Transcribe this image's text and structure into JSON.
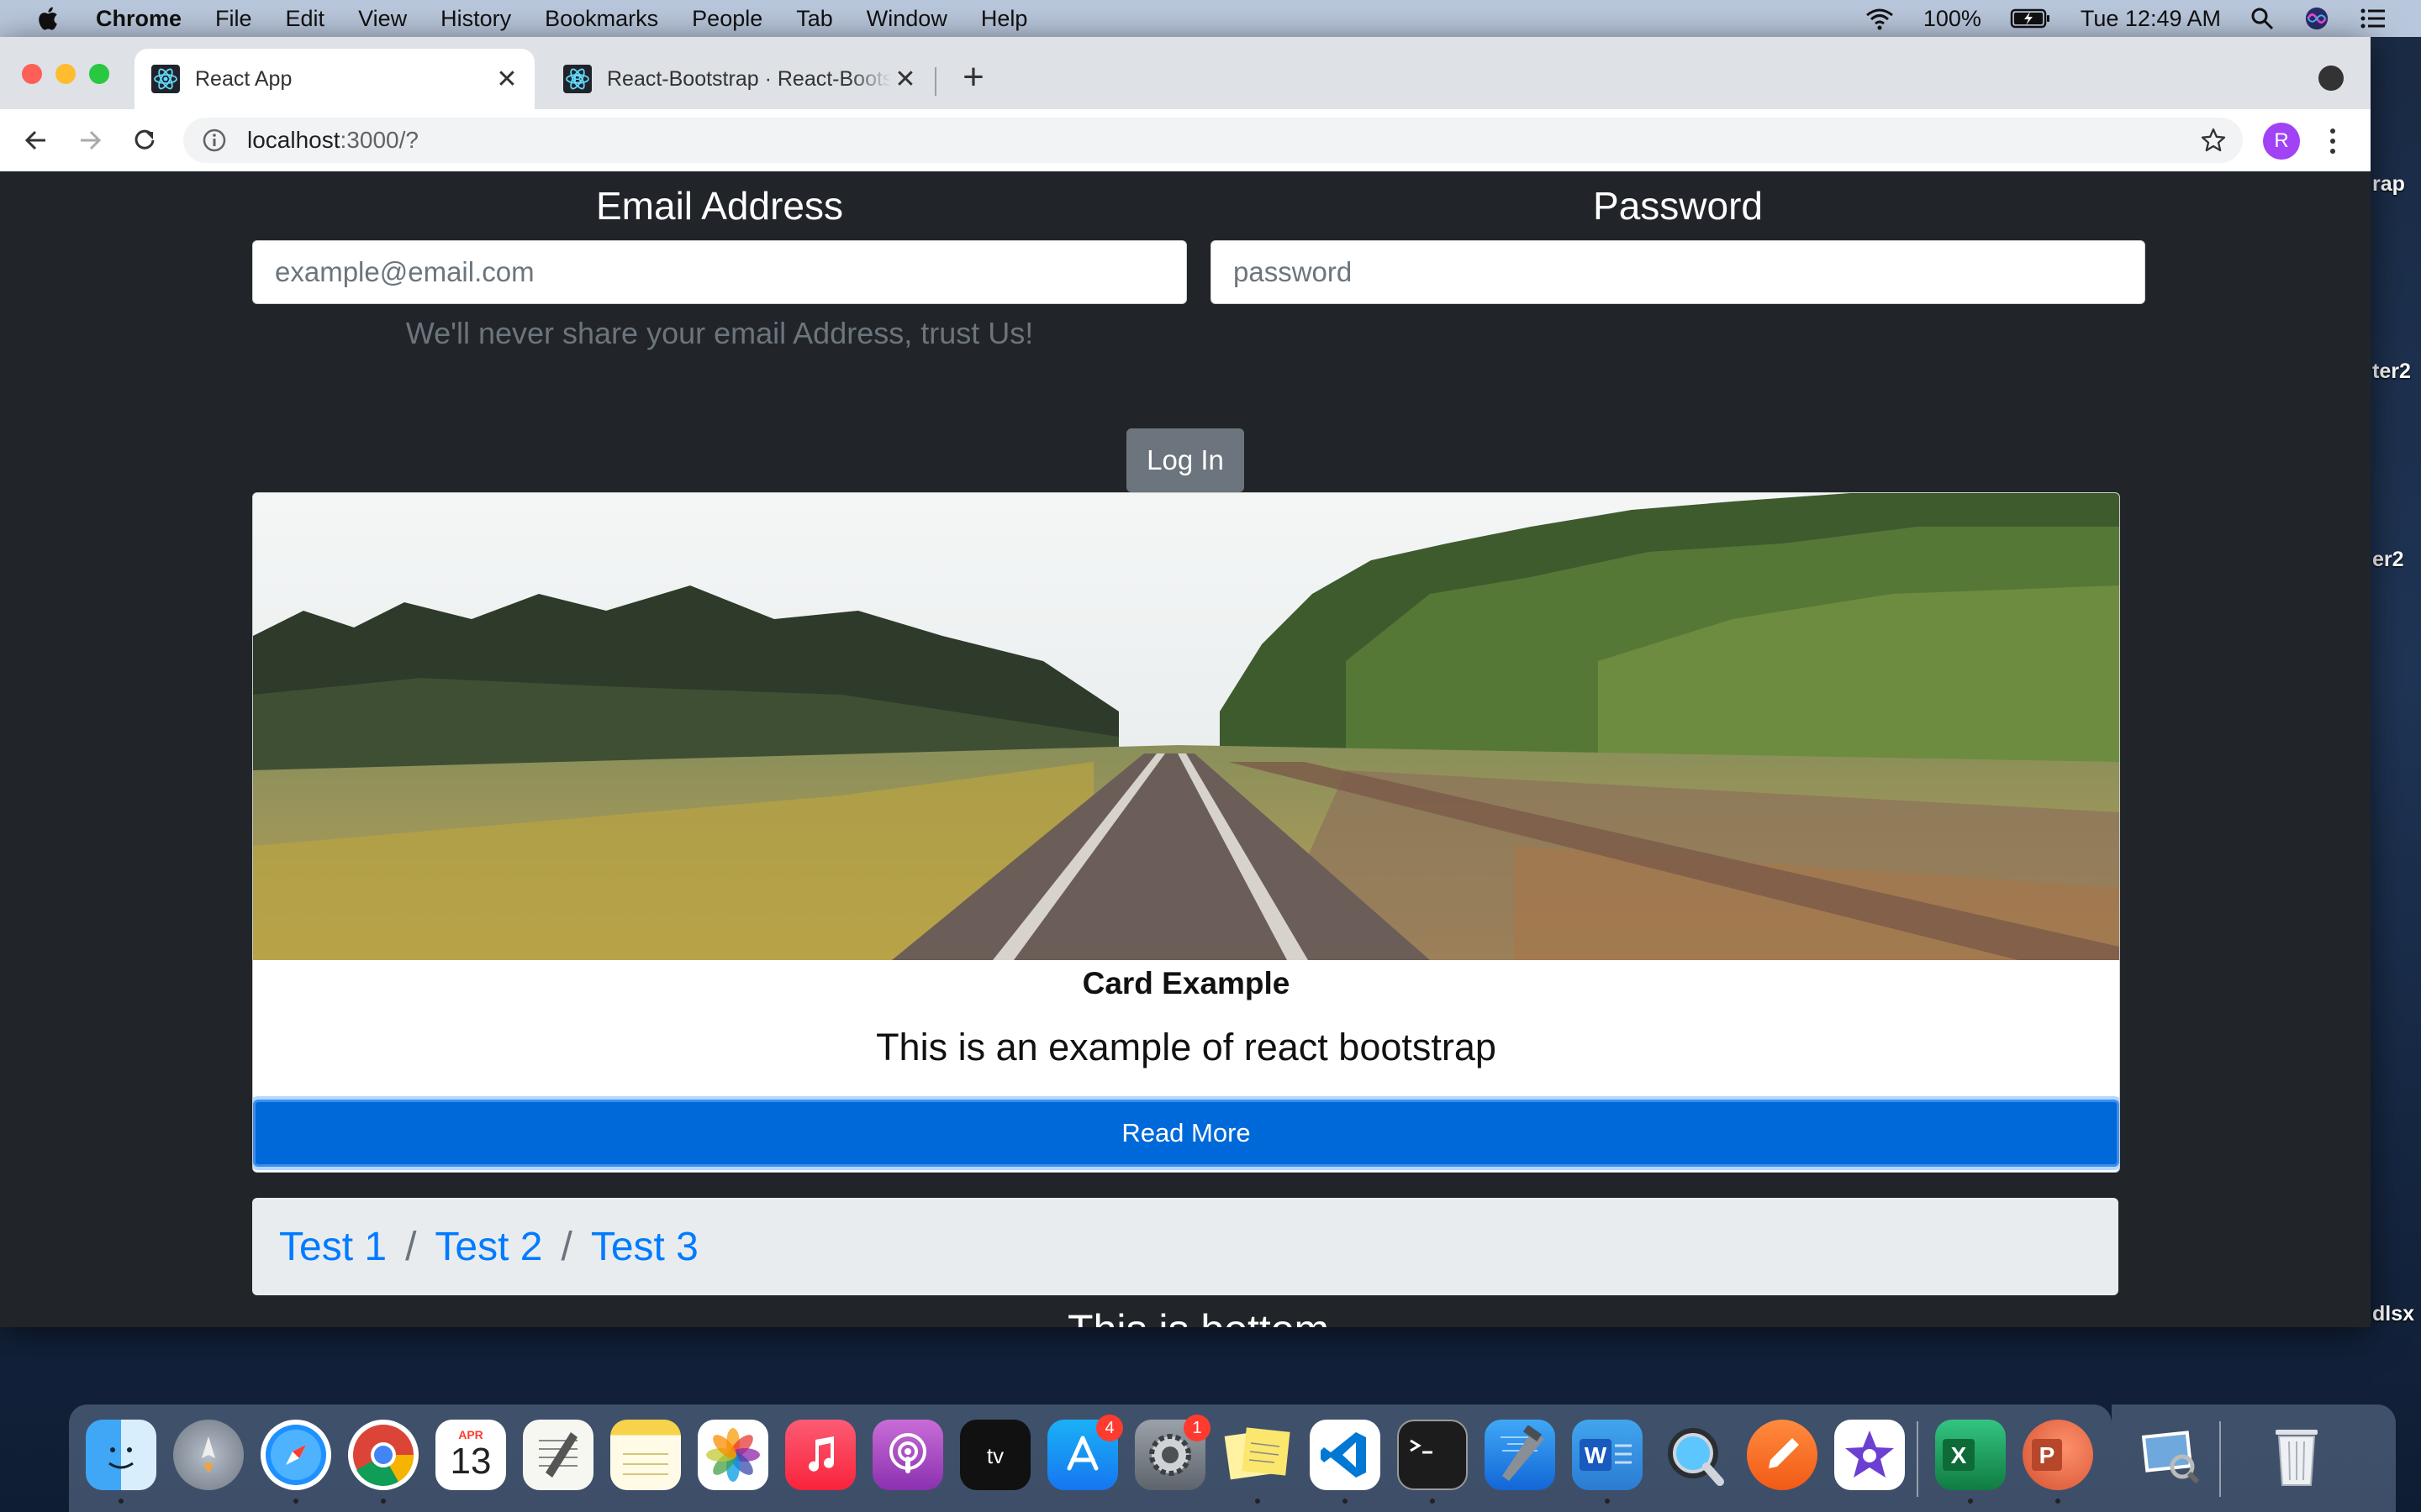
{
  "menubar": {
    "app_name": "Chrome",
    "items": [
      "File",
      "Edit",
      "View",
      "History",
      "Bookmarks",
      "People",
      "Tab",
      "Window",
      "Help"
    ],
    "battery": "100%",
    "clock": "Tue 12:49 AM"
  },
  "desktop": {
    "labels": [
      "rap",
      "ter2",
      "er2",
      "dlsx"
    ]
  },
  "browser": {
    "tabs": [
      {
        "title": "React App",
        "active": true
      },
      {
        "title": "React-Bootstrap · React-Bootstrap Documentation",
        "active": false
      }
    ],
    "url_host": "localhost",
    "url_rest": ":3000/?",
    "profile_initial": "R"
  },
  "page": {
    "email_label": "Email Address",
    "email_placeholder": "example@email.com",
    "email_help": "We'll never share your email Address, trust Us!",
    "password_label": "Password",
    "password_placeholder": "password",
    "login_button": "Log In",
    "card": {
      "title": "Card Example",
      "text": "This is an example of react bootstrap",
      "button": "Read More"
    },
    "breadcrumb": [
      "Test 1",
      "Test 2",
      "Test 3"
    ],
    "breadcrumb_separator": "/",
    "footer_text": "This is bottom"
  },
  "dock": {
    "apps": [
      "Finder",
      "Launchpad",
      "Safari",
      "Google Chrome",
      "Calendar",
      "TextEdit",
      "Notes",
      "Photos",
      "Music",
      "Podcasts",
      "TV",
      "App Store",
      "System Preferences",
      "Stickies",
      "Visual Studio Code",
      "Terminal",
      "Xcode",
      "Microsoft Word",
      "QuickTime Player",
      "Sketch",
      "iMovie",
      "Microsoft Excel",
      "Microsoft PowerPoint",
      "Preview",
      "Trash"
    ],
    "calendar_month": "APR",
    "calendar_day": "13",
    "app_store_badge": "4",
    "system_prefs_badge": "1"
  },
  "colors": {
    "page_background": "#212529",
    "primary": "#007bff",
    "primary_button": "#0069d9",
    "secondary_button": "#6c757d",
    "breadcrumb_background": "#e9ecef"
  }
}
